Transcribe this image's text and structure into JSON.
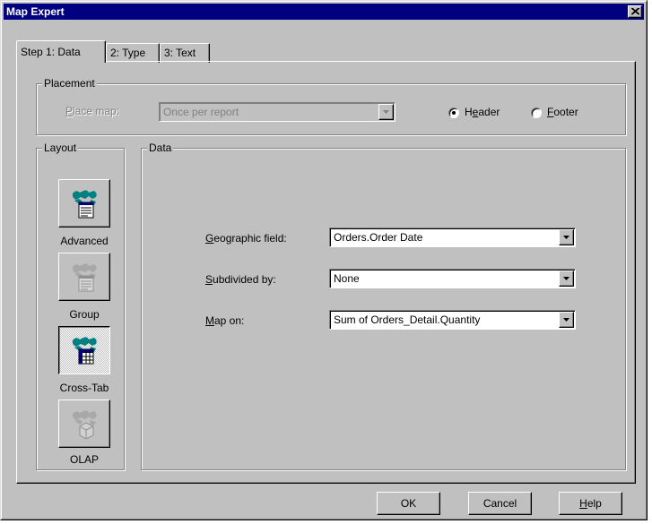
{
  "window": {
    "title": "Map Expert",
    "close_icon": "close-icon"
  },
  "tabs": [
    {
      "label": "Step 1: Data",
      "active": true
    },
    {
      "label": "2: Type",
      "active": false
    },
    {
      "label": "3: Text",
      "active": false
    }
  ],
  "placement": {
    "group_label": "Placement",
    "place_map_label": "Place map:",
    "place_map_value": "Once per report",
    "place_map_disabled": true,
    "header_label": "Header",
    "footer_label": "Footer",
    "selected": "Header"
  },
  "layout": {
    "group_label": "Layout",
    "items": [
      {
        "label": "Advanced",
        "icon": "advanced-layout-icon",
        "pressed": false,
        "disabled": false
      },
      {
        "label": "Group",
        "icon": "group-layout-icon",
        "pressed": false,
        "disabled": true
      },
      {
        "label": "Cross-Tab",
        "icon": "crosstab-layout-icon",
        "pressed": true,
        "disabled": false
      },
      {
        "label": "OLAP",
        "icon": "olap-layout-icon",
        "pressed": false,
        "disabled": true
      }
    ]
  },
  "data": {
    "group_label": "Data",
    "geographic_field_label": "Geographic field:",
    "geographic_field_value": "Orders.Order Date",
    "subdivided_by_label": "Subdivided by:",
    "subdivided_by_value": "None",
    "map_on_label": "Map on:",
    "map_on_value": "Sum of Orders_Detail.Quantity"
  },
  "buttons": {
    "ok": "OK",
    "cancel": "Cancel",
    "help": "Help"
  },
  "colors": {
    "titlebar": "#000080",
    "face": "#c0c0c0",
    "map_teal": "#008080"
  }
}
